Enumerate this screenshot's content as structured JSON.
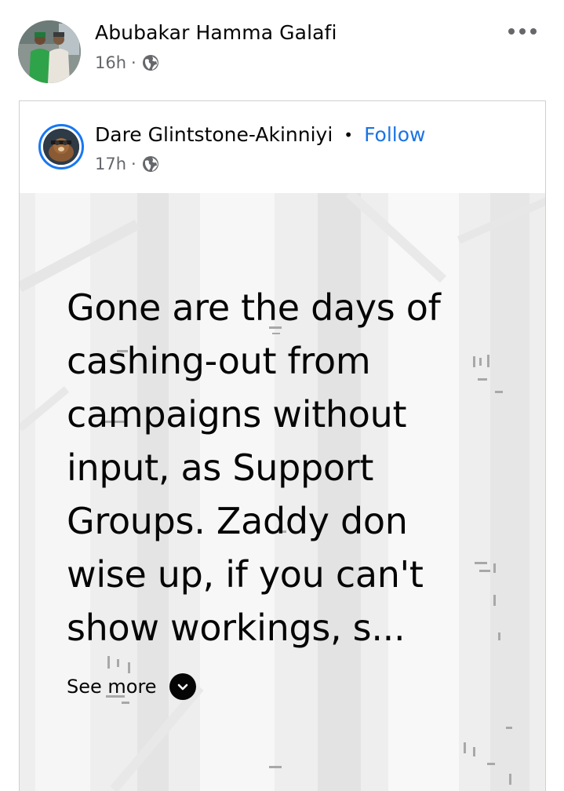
{
  "post": {
    "author": "Abubakar Hamma Galafi",
    "time": "16h",
    "separator": "·",
    "privacy_icon": "globe-icon",
    "more_icon": "more-options-icon"
  },
  "shared_post": {
    "author": "Dare Glintstone-Akinniyi",
    "separator": "•",
    "follow_label": "Follow",
    "time": "17h",
    "meta_separator": "·",
    "privacy_icon": "globe-icon",
    "text": "Gone are the days of\ncashing-out from\ncampaigns without\ninput, as Support\nGroups. Zaddy don\nwise up, if you can't\nshow workings, s...",
    "see_more_label": "See more",
    "see_more_icon": "chevron-down-icon"
  },
  "colors": {
    "link_blue": "#1b74e4",
    "ring_blue": "#1877f2",
    "meta_gray": "#65676b",
    "post_background": "#efefef"
  }
}
